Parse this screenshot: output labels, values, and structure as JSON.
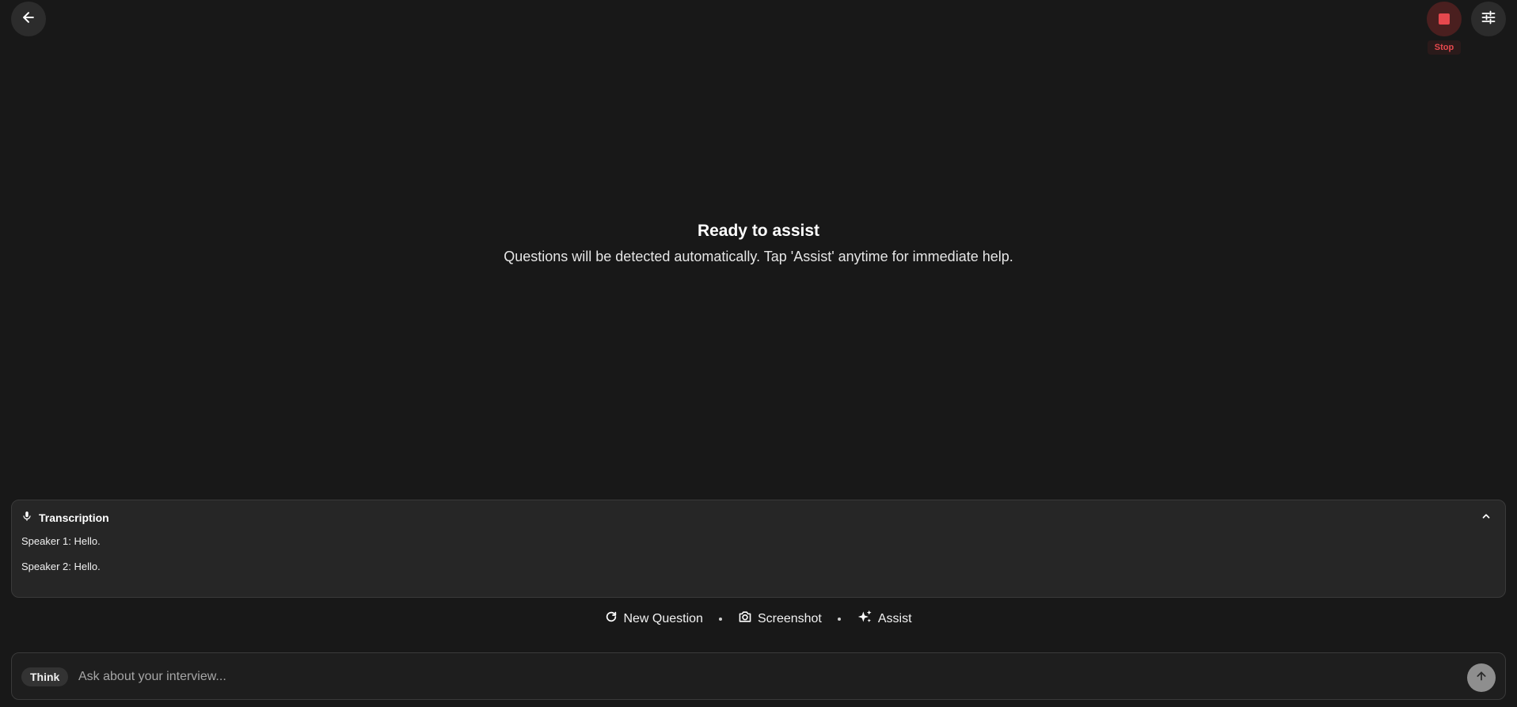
{
  "header": {
    "back_icon": "arrow-left-icon",
    "stop_icon": "stop-square-icon",
    "stop_label": "Stop",
    "settings_icon": "sliders-icon"
  },
  "main": {
    "title": "Ready to assist",
    "subtitle": "Questions will be detected automatically. Tap 'Assist' anytime for immediate help."
  },
  "transcription": {
    "icon": "microphone-icon",
    "title": "Transcription",
    "collapse_icon": "chevron-up-icon",
    "lines": [
      "Speaker 1: Hello.",
      "Speaker 2: Hello."
    ]
  },
  "actions": {
    "new_question": {
      "label": "New Question",
      "icon": "refresh-icon"
    },
    "screenshot": {
      "label": "Screenshot",
      "icon": "camera-icon"
    },
    "assist": {
      "label": "Assist",
      "icon": "sparkles-icon"
    }
  },
  "input": {
    "think_label": "Think",
    "placeholder": "Ask about your interview...",
    "value": "",
    "send_icon": "arrow-up-icon"
  },
  "colors": {
    "background": "#181818",
    "stop_accent": "#e5484d",
    "panel": "#262626"
  }
}
